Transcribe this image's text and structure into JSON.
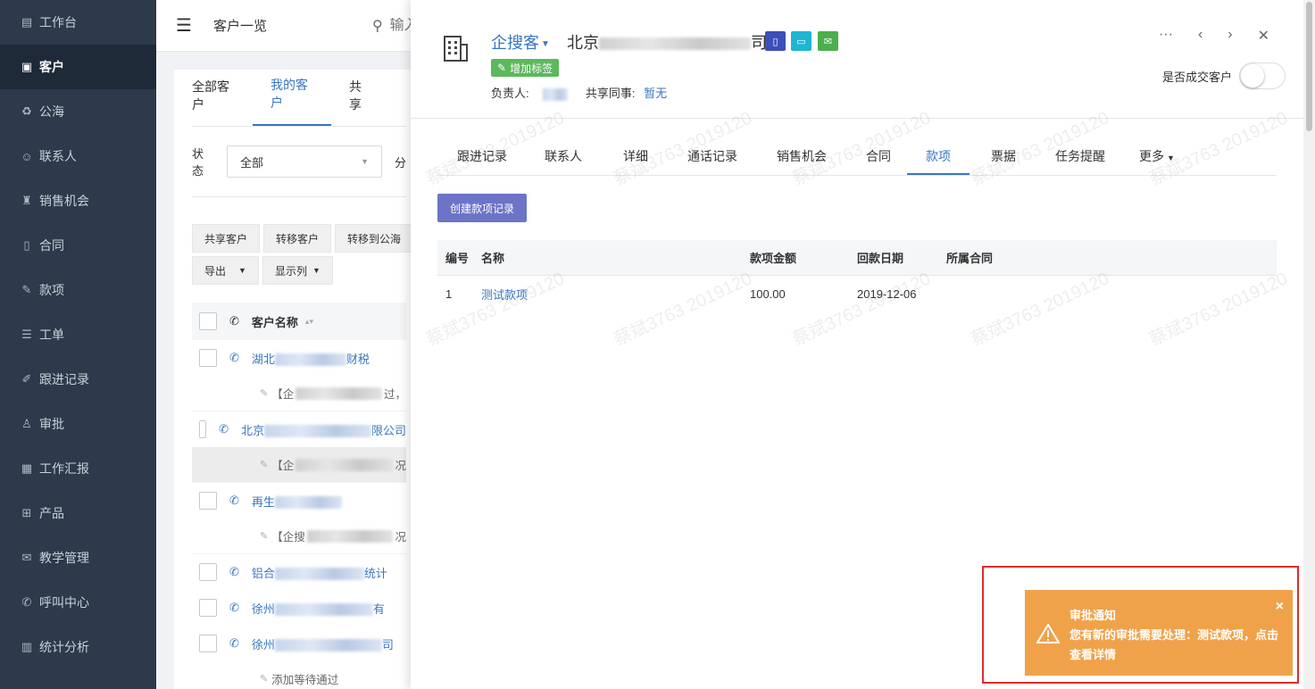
{
  "sidebar": {
    "items": [
      {
        "label": "工作台",
        "icon": "dashboard-icon",
        "glyph": "▤"
      },
      {
        "label": "客户",
        "icon": "customer-icon",
        "glyph": "▣",
        "active": true
      },
      {
        "label": "公海",
        "icon": "pool-icon",
        "glyph": "♻"
      },
      {
        "label": "联系人",
        "icon": "contact-icon",
        "glyph": "☺"
      },
      {
        "label": "销售机会",
        "icon": "opportunity-icon",
        "glyph": "♜"
      },
      {
        "label": "合同",
        "icon": "contract-icon",
        "glyph": "▯"
      },
      {
        "label": "款项",
        "icon": "payment-icon",
        "glyph": "✎"
      },
      {
        "label": "工单",
        "icon": "ticket-icon",
        "glyph": "☰"
      },
      {
        "label": "跟进记录",
        "icon": "followup-icon",
        "glyph": "✐"
      },
      {
        "label": "审批",
        "icon": "approval-icon",
        "glyph": "♙"
      },
      {
        "label": "工作汇报",
        "icon": "report-icon",
        "glyph": "▦"
      },
      {
        "label": "产品",
        "icon": "product-icon",
        "glyph": "⊞"
      },
      {
        "label": "教学管理",
        "icon": "teaching-icon",
        "glyph": "✉"
      },
      {
        "label": "呼叫中心",
        "icon": "callcenter-icon",
        "glyph": "✆"
      },
      {
        "label": "统计分析",
        "icon": "stats-icon",
        "glyph": "▥"
      }
    ]
  },
  "topbar": {
    "title": "客户一览",
    "search_placeholder": "输入"
  },
  "list": {
    "tabs": [
      "全部客户",
      "我的客户",
      "共享"
    ],
    "filter_label": "状态",
    "filter_value": "全部",
    "filter_extra": "分",
    "buttons": [
      "共享客户",
      "转移客户",
      "转移到公海",
      "导出",
      "显示列"
    ],
    "column_name": "客户名称",
    "rows": [
      {
        "prefix": "湖北",
        "suffix": "财税",
        "memo_prefix": "【企",
        "memo_suffix": "过，"
      },
      {
        "prefix": "北京",
        "suffix": "限公司",
        "memo_prefix": "【企",
        "memo_suffix": "况"
      },
      {
        "prefix": "再生",
        "suffix": "",
        "memo_prefix": "【企搜",
        "memo_suffix": "况"
      },
      {
        "prefix": "铝合",
        "suffix": "统计"
      },
      {
        "prefix": "徐州",
        "suffix": "有"
      },
      {
        "prefix": "徐州",
        "suffix": "司",
        "memo_prefix": "添加等待通过",
        "memo_suffix": ""
      }
    ]
  },
  "drawer": {
    "brand": "企搜客",
    "company_prefix": "北京",
    "company_suffix": "司",
    "tag_button": "增加标签",
    "owner_label": "负责人:",
    "share_label": "共享同事:",
    "share_value": "暂无",
    "deal_label": "是否成交客户",
    "tabs": [
      "跟进记录",
      "联系人",
      "详细",
      "通话记录",
      "销售机会",
      "合同",
      "款项",
      "票据",
      "任务提醒",
      "更多"
    ],
    "active_tab": "款项",
    "create_button": "创建款项记录",
    "table": {
      "headers": [
        "编号",
        "名称",
        "款项金额",
        "回款日期",
        "所属合同"
      ],
      "rows": [
        {
          "no": "1",
          "name": "测试款项",
          "amount": "100.00",
          "date": "2019-12-06",
          "contract": ""
        }
      ]
    },
    "watermark": "蔡斌3763 2019120"
  },
  "notification": {
    "title": "审批通知",
    "body": "您有新的审批需要处理：测试款项，点击查看详情",
    "close": "×"
  },
  "colors": {
    "sidebar_bg": "#2d3a4b",
    "accent": "#3876c2",
    "create_btn": "#6b74c7",
    "tag_btn": "#5cb85c",
    "notify_bg": "#f0a24a",
    "highlight_frame": "#e02b2b"
  }
}
